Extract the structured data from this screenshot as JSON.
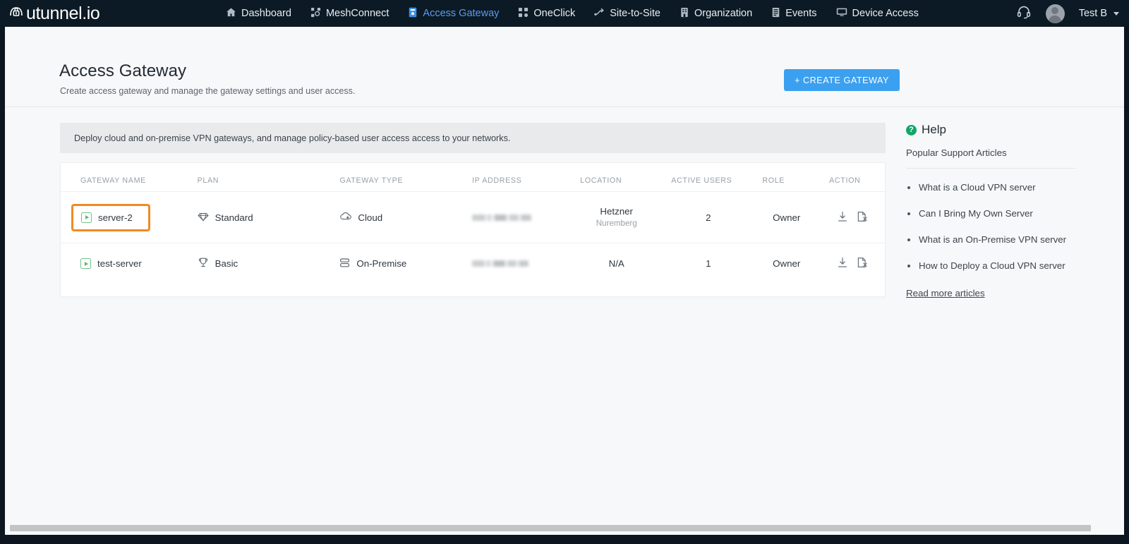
{
  "brand": {
    "name": "utunnel.io",
    "logo_icon": "tunnel-lock-icon"
  },
  "nav": {
    "items": [
      {
        "label": "Dashboard",
        "icon": "home-icon",
        "active": false
      },
      {
        "label": "MeshConnect",
        "icon": "mesh-icon",
        "active": false
      },
      {
        "label": "Access Gateway",
        "icon": "gateway-icon",
        "active": true
      },
      {
        "label": "OneClick",
        "icon": "oneclick-icon",
        "active": false
      },
      {
        "label": "Site-to-Site",
        "icon": "site-to-site-icon",
        "active": false
      },
      {
        "label": "Organization",
        "icon": "organization-icon",
        "active": false
      },
      {
        "label": "Events",
        "icon": "events-icon",
        "active": false
      },
      {
        "label": "Device Access",
        "icon": "monitor-icon",
        "active": false
      }
    ],
    "support_icon": "headset-icon",
    "user": {
      "name": "Test B",
      "avatar_icon": "avatar-icon",
      "caret_icon": "chevron-down-icon"
    }
  },
  "header": {
    "title": "Access Gateway",
    "subtitle": "Create access gateway and manage the gateway settings and user access.",
    "create_button": "+ CREATE GATEWAY",
    "accent_color": "#3ba0ef"
  },
  "banner": {
    "text": "Deploy cloud and on-premise VPN gateways, and manage policy-based user access access to your networks."
  },
  "table": {
    "columns": [
      "GATEWAY NAME",
      "PLAN",
      "GATEWAY TYPE",
      "IP ADDRESS",
      "LOCATION",
      "ACTIVE USERS",
      "ROLE",
      "ACTION"
    ],
    "rows": [
      {
        "name": "server-2",
        "name_status_icon": "server-running-icon",
        "highlighted": true,
        "plan": "Standard",
        "plan_icon": "diamond-icon",
        "type": "Cloud",
        "type_icon": "cloud-icon",
        "ip": "",
        "ip_redacted": true,
        "location": "Hetzner",
        "location_sub": "Nuremberg",
        "active_users": "2",
        "role": "Owner",
        "actions": [
          {
            "icon": "download-icon",
            "label": "Download config"
          },
          {
            "icon": "revoke-config-icon",
            "label": "Revoke config"
          }
        ]
      },
      {
        "name": "test-server",
        "name_status_icon": "server-running-icon",
        "highlighted": false,
        "plan": "Basic",
        "plan_icon": "trophy-icon",
        "type": "On-Premise",
        "type_icon": "stacked-server-icon",
        "ip": "",
        "ip_redacted": true,
        "location": "N/A",
        "location_sub": "",
        "active_users": "1",
        "role": "Owner",
        "actions": [
          {
            "icon": "download-icon",
            "label": "Download config"
          },
          {
            "icon": "revoke-config-icon",
            "label": "Revoke config"
          }
        ]
      }
    ]
  },
  "help": {
    "title": "Help",
    "title_icon": "question-circle-icon",
    "subtitle": "Popular Support Articles",
    "accent_color": "#0fa866",
    "articles": [
      "What is a Cloud VPN server",
      "Can I Bring My Own Server",
      "What is an On-Premise VPN server",
      "How to Deploy a Cloud VPN server"
    ],
    "read_more": "Read more articles"
  },
  "highlight": {
    "color": "#ef8b23",
    "target": "server-2"
  }
}
